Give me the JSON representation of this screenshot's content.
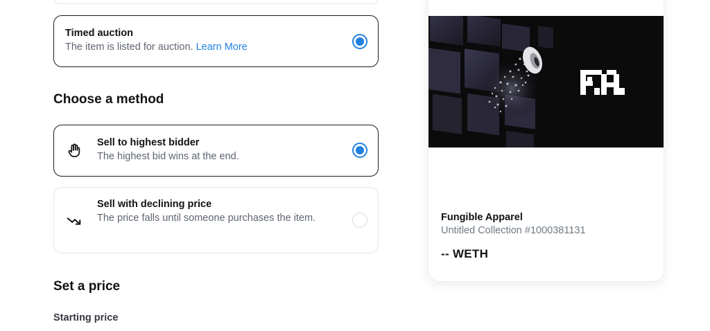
{
  "listing": {
    "auction_type": {
      "title": "Timed auction",
      "description": "The item is listed for auction.",
      "link": "Learn More"
    },
    "method_heading": "Choose a method",
    "methods": [
      {
        "title": "Sell to highest bidder",
        "description": "The highest bid wins at the end.",
        "icon": "hand-icon",
        "selected": true
      },
      {
        "title": "Sell with declining price",
        "description": "The price falls until someone purchases the item.",
        "icon": "trending-down-icon",
        "selected": false
      }
    ],
    "price_heading": "Set a price",
    "starting_price_label": "Starting price"
  },
  "preview": {
    "name": "Fungible Apparel",
    "collection": "Untitled Collection #1000381131",
    "price": "-- WETH"
  },
  "colors": {
    "accent": "#2081e2",
    "text": "#121212",
    "muted": "#5e6470"
  }
}
